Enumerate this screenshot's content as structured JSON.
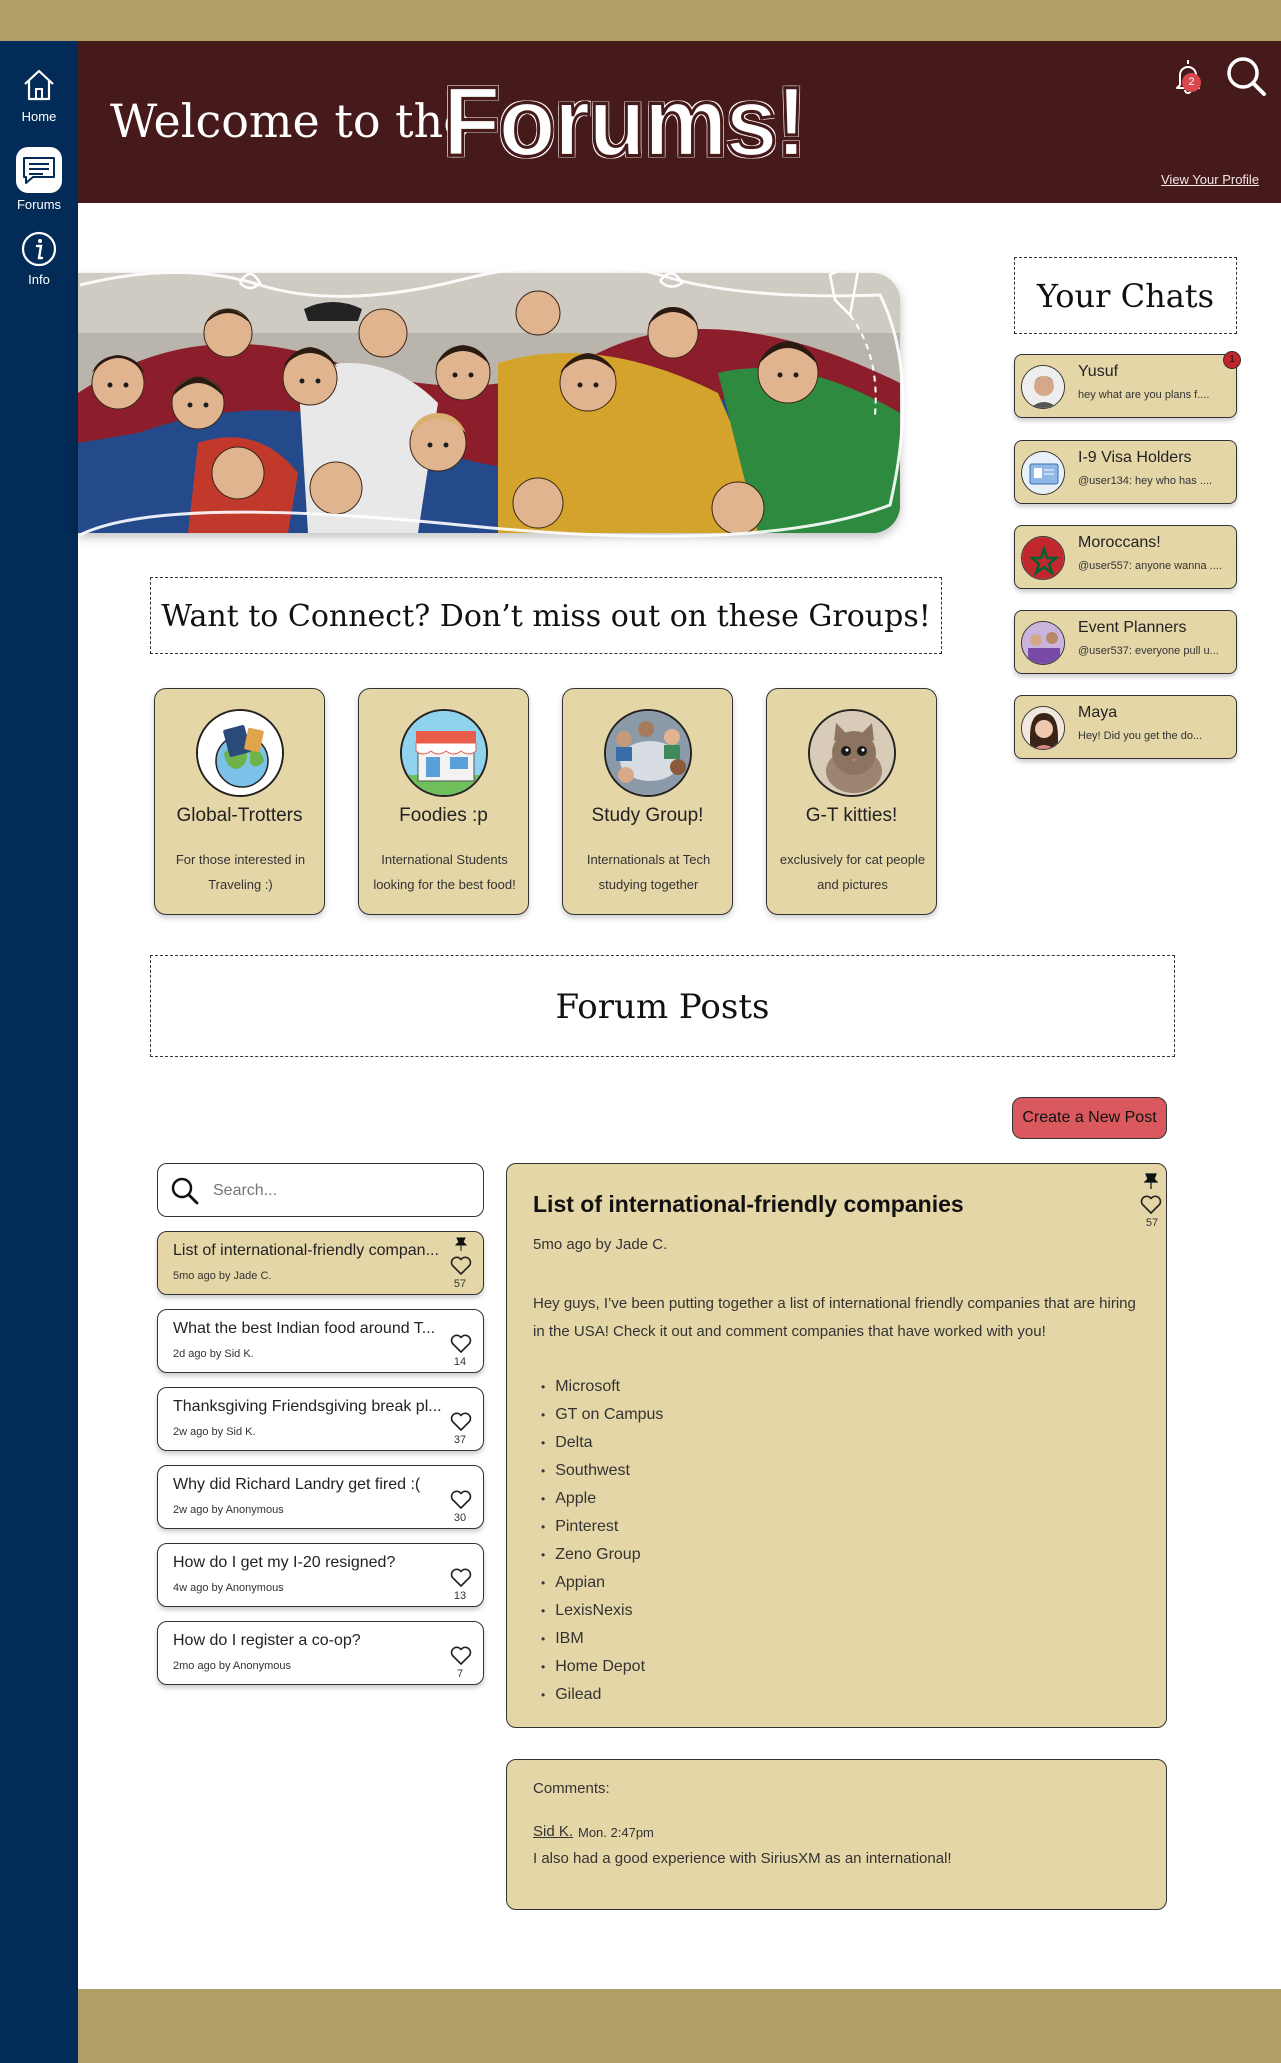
{
  "colors": {
    "sidebar": "#032b57",
    "header": "#461a1a",
    "gold_strip": "#b09e64",
    "card": "#e5d6a8",
    "create_button": "#d9595f",
    "notification_badge": "#d9484d"
  },
  "sidebar": {
    "items": [
      {
        "label": "Home",
        "icon": "home-icon"
      },
      {
        "label": "Forums",
        "icon": "forums-icon",
        "active": true
      },
      {
        "label": "Info",
        "icon": "info-icon"
      }
    ]
  },
  "header": {
    "welcome": "Welcome to the",
    "title": "Forums!",
    "notification_count": "2",
    "view_profile": "View Your Profile"
  },
  "connect": {
    "heading": "Want to Connect? Don’t miss out on these Groups!"
  },
  "groups": [
    {
      "name": "Global-Trotters",
      "desc": "For those interested in Traveling :)",
      "icon": "globe-icon"
    },
    {
      "name": "Foodies :p",
      "desc": "International Students looking for the best food!",
      "icon": "restaurant-icon"
    },
    {
      "name": "Study Group!",
      "desc": "Internationals at Tech studying together",
      "icon": "study-photo"
    },
    {
      "name": "G-T kitties!",
      "desc": "exclusively for cat people and  pictures",
      "icon": "kitten-photo"
    }
  ],
  "chats": {
    "title": "Your Chats",
    "unread_badge": "1",
    "items": [
      {
        "name": "Yusuf",
        "preview": "hey what are you plans f...."
      },
      {
        "name": "I-9 Visa Holders",
        "preview": "@user134: hey who has ...."
      },
      {
        "name": "Moroccans!",
        "preview": "@user557: anyone wanna ...."
      },
      {
        "name": "Event Planners",
        "preview": "@user537: everyone pull u..."
      },
      {
        "name": "Maya",
        "preview": "Hey! Did you get the do..."
      }
    ]
  },
  "posts": {
    "heading": "Forum Posts",
    "create_label": "Create a New Post",
    "search_placeholder": "Search...",
    "items": [
      {
        "title": "List of international-friendly compan...",
        "meta": "5mo ago by Jade C.",
        "likes": "57",
        "pinned": true
      },
      {
        "title": "What the best Indian food around T...",
        "meta": "2d ago by Sid K.",
        "likes": "14"
      },
      {
        "title": "Thanksgiving Friendsgiving break pl...",
        "meta": "2w ago by Sid K.",
        "likes": "37"
      },
      {
        "title": "Why did Richard Landry get fired :(",
        "meta": "2w ago by Anonymous",
        "likes": "30"
      },
      {
        "title": "How do I get my I-20 resigned?",
        "meta": "4w ago by Anonymous",
        "likes": "13"
      },
      {
        "title": "How do I register a co-op?",
        "meta": "2mo ago by Anonymous",
        "likes": "7"
      }
    ]
  },
  "detail": {
    "title": "List of international-friendly companies",
    "meta": "5mo ago by Jade C.",
    "likes": "57",
    "body": "Hey guys, I’ve been putting together a list of international friendly companies that are hiring in the USA! Check it out and comment companies that have worked with you!",
    "companies": [
      "Microsoft",
      "GT on Campus",
      "Delta",
      "Southwest",
      "Apple",
      "Pinterest",
      "Zeno Group",
      "Appian",
      "LexisNexis",
      "IBM",
      "Home Depot",
      "Gilead"
    ]
  },
  "comments": {
    "label": "Comments:",
    "items": [
      {
        "author": "Sid K.",
        "time": "Mon. 2:47pm",
        "text": "I also had a good experience with SiriusXM as an international!"
      }
    ]
  }
}
